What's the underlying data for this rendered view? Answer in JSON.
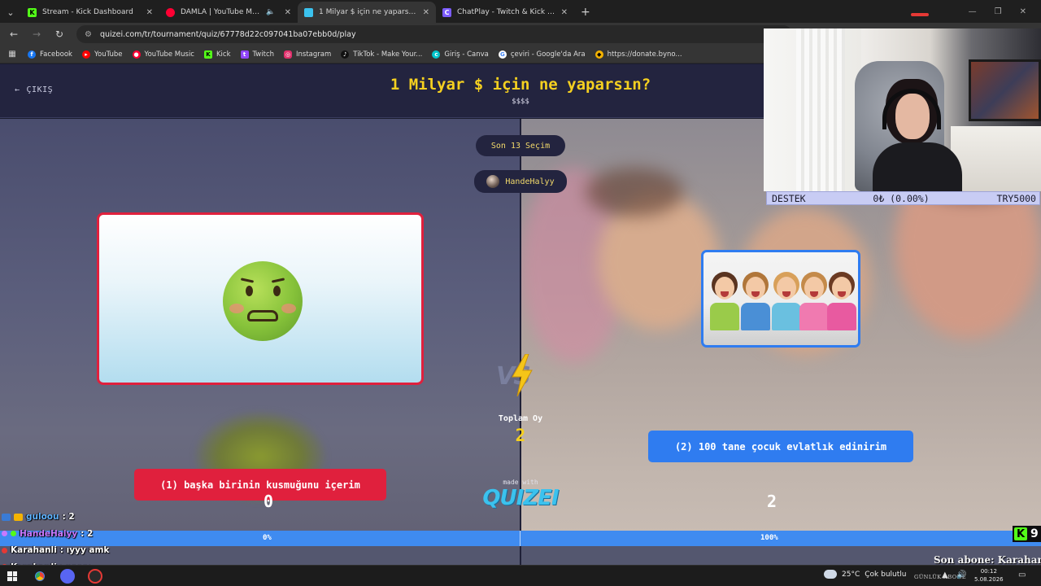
{
  "browser": {
    "tabs": [
      {
        "label": "Stream - Kick Dashboard",
        "icon": "kick-icon",
        "color": "#53fc18",
        "active": false
      },
      {
        "label": "DAMLA | YouTube Music",
        "icon": "youtube-music-icon",
        "color": "#ff0033",
        "active": false
      },
      {
        "label": "1 Milyar $ için ne yaparsın? - Ti",
        "icon": "quizei-icon",
        "color": "#3bc2ee",
        "active": true
      },
      {
        "label": "ChatPlay - Twitch & Kick İzleyici",
        "icon": "chatplay-icon",
        "color": "#7c5cff",
        "active": false
      }
    ],
    "new_tab": "+",
    "url": "quizei.com/tr/tournament/quiz/67778d22c097041ba07ebb0d/play",
    "bookmarks": [
      {
        "label": "Facebook",
        "icon": "facebook-icon",
        "color": "#1877f2"
      },
      {
        "label": "YouTube",
        "icon": "youtube-icon",
        "color": "#ff0000"
      },
      {
        "label": "YouTube Music",
        "icon": "youtube-music-icon",
        "color": "#ff0033"
      },
      {
        "label": "Kick",
        "icon": "kick-icon",
        "color": "#53fc18"
      },
      {
        "label": "Twitch",
        "icon": "twitch-icon",
        "color": "#9146ff"
      },
      {
        "label": "Instagram",
        "icon": "instagram-icon",
        "color": "#e1306c"
      },
      {
        "label": "TikTok - Make Your...",
        "icon": "tiktok-icon",
        "color": "#111111"
      },
      {
        "label": "Giriş - Canva",
        "icon": "canva-icon",
        "color": "#00c4cc"
      },
      {
        "label": "çeviri - Google'da Ara",
        "icon": "google-icon",
        "color": "#4285f4"
      },
      {
        "label": "https://donate.byno...",
        "icon": "donate-icon",
        "color": "#f5b301"
      }
    ]
  },
  "quiz": {
    "exit_label": "ÇIKIŞ",
    "title": "1 Milyar $ için ne yaparsın?",
    "subtitle": "$$$$",
    "round_label": "Son 13 Seçim",
    "user_name": "HandeHalyy",
    "total_label": "Toplam Oy",
    "total_value": "2",
    "option_left": "(1) başka birinin kusmuğunu içerim",
    "option_right": "(2) 100 tane çocuk evlatlık edinirim",
    "count_left": "0",
    "count_right": "2",
    "pct_left": "0%",
    "pct_right": "100%",
    "made_with": "made with",
    "logo": "QUIZEI",
    "accent_left": "#e0203d",
    "accent_right": "#2f7cf0",
    "accent_title": "#f5d020"
  },
  "overlay": {
    "destek_label": "DESTEK",
    "destek_amount": "0₺ (0.00%)",
    "destek_goal": "TRY5000",
    "chat": [
      {
        "user": "guloou",
        "text": " : 2",
        "color": "#5fb3ff"
      },
      {
        "user": "HandeHalyy",
        "text": " : 2",
        "color": "#c879ff"
      },
      {
        "user": "Karahanli",
        "text": " : ıyyy amk",
        "color": "#ffffff"
      },
      {
        "user": "Karahanli",
        "text": " : ıyyyy",
        "color": "#ffffff"
      }
    ],
    "kick_count": "9",
    "last_sub": "Son abone: Karahanli"
  },
  "taskbar": {
    "weather": "25°C",
    "weather_desc": "Çok bulutlu",
    "ticker": "GÜNLÜK ABONE",
    "time": "00:12",
    "date": "5.08.2026"
  }
}
